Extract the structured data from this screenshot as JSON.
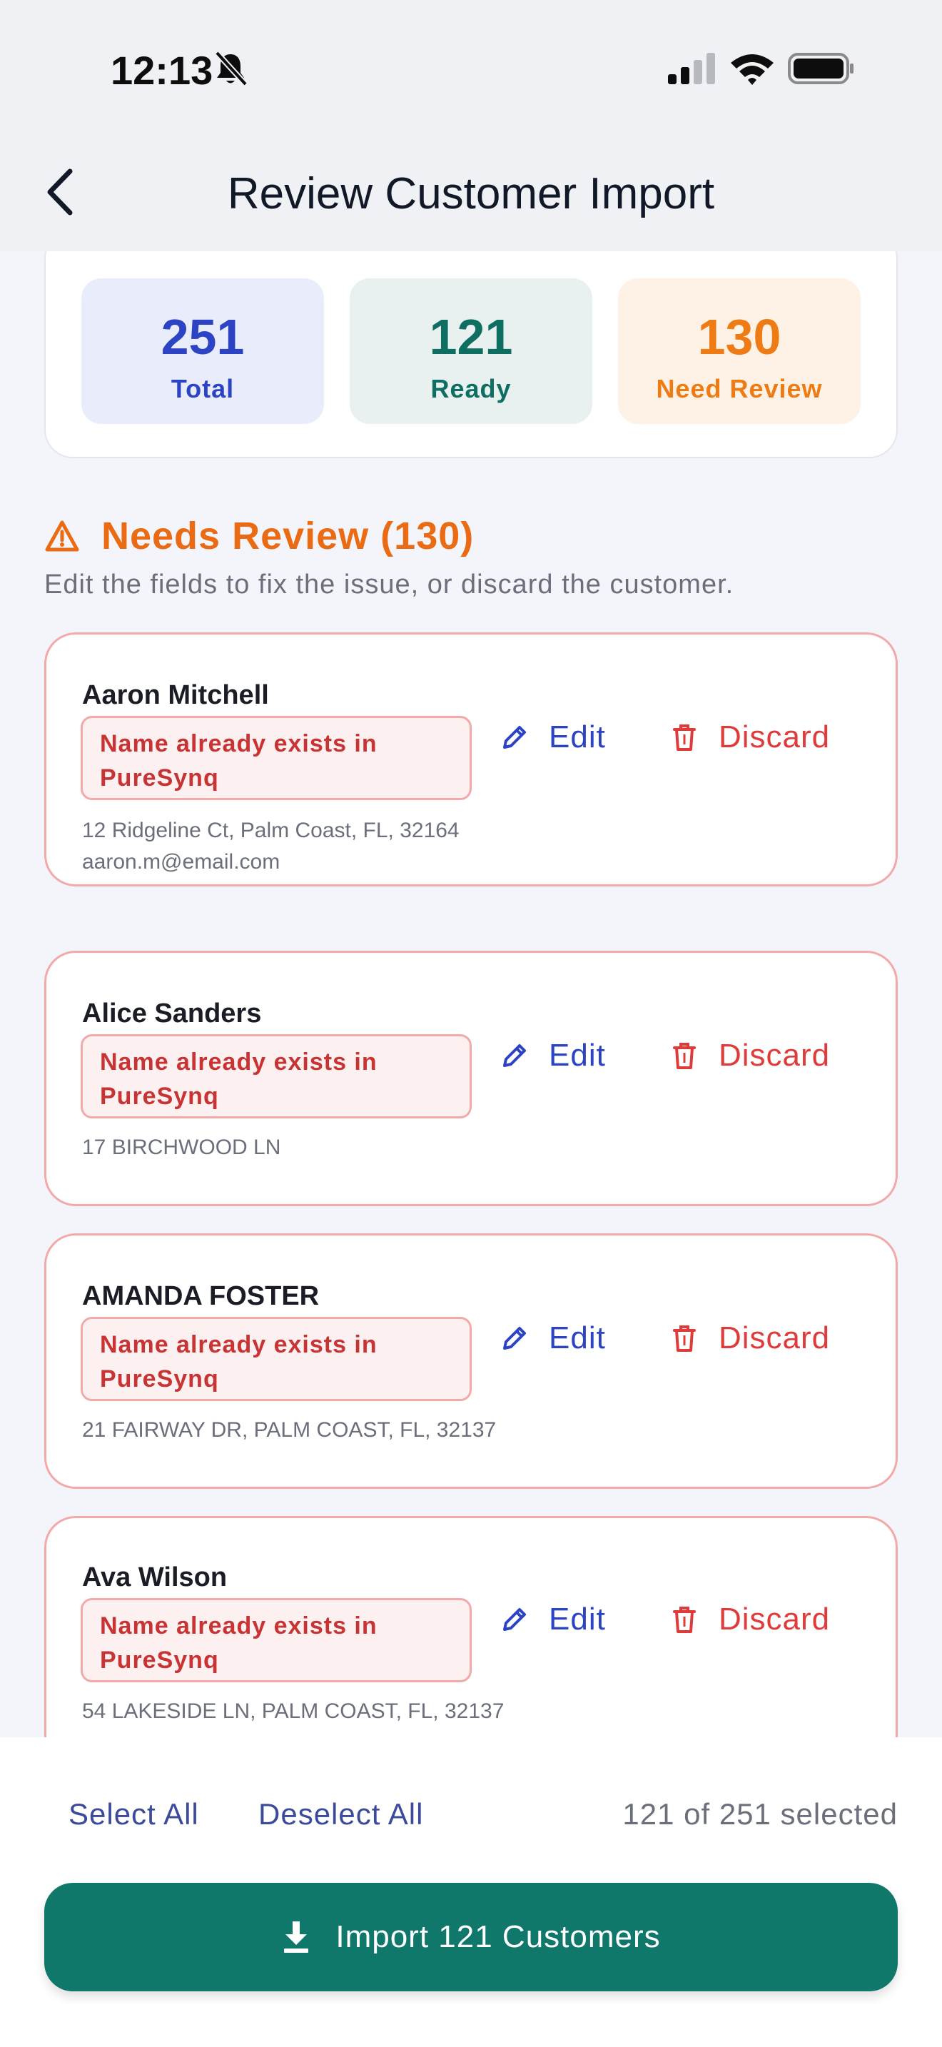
{
  "status_bar": {
    "time": "12:13"
  },
  "nav": {
    "title": "Review Customer Import"
  },
  "summary": {
    "total": {
      "value": "251",
      "label": "Total"
    },
    "ready": {
      "value": "121",
      "label": "Ready"
    },
    "review": {
      "value": "130",
      "label": "Need Review"
    }
  },
  "section": {
    "title": "Needs Review (130)",
    "subtitle": "Edit the fields to fix the issue, or discard the customer."
  },
  "actions": {
    "edit": "Edit",
    "discard": "Discard"
  },
  "customers": [
    {
      "name": "Aaron Mitchell",
      "issue_line1": "Name already exists in",
      "issue_line2": "PureSynq",
      "address": "12 Ridgeline Ct, Palm Coast, FL, 32164",
      "email": "aaron.m@email.com"
    },
    {
      "name": "Alice Sanders",
      "issue_line1": "Name already exists in",
      "issue_line2": "PureSynq",
      "address": "17 BIRCHWOOD LN"
    },
    {
      "name": "AMANDA FOSTER",
      "issue_line1": "Name already exists in",
      "issue_line2": "PureSynq",
      "address": "21 FAIRWAY DR, PALM COAST, FL, 32137"
    },
    {
      "name": "Ava Wilson",
      "issue_line1": "Name already exists in",
      "issue_line2": "PureSynq",
      "address": "54 LAKESIDE LN, PALM COAST, FL, 32137"
    }
  ],
  "footer": {
    "select_all": "Select All",
    "deselect_all": "Deselect All",
    "selection_count": "121 of 251 selected",
    "import_label": "Import 121 Customers"
  },
  "colors": {
    "primary": "#0f786b",
    "accent_blue": "#2c44c4",
    "warning": "#ea6b13",
    "error": "#e03b3b"
  }
}
